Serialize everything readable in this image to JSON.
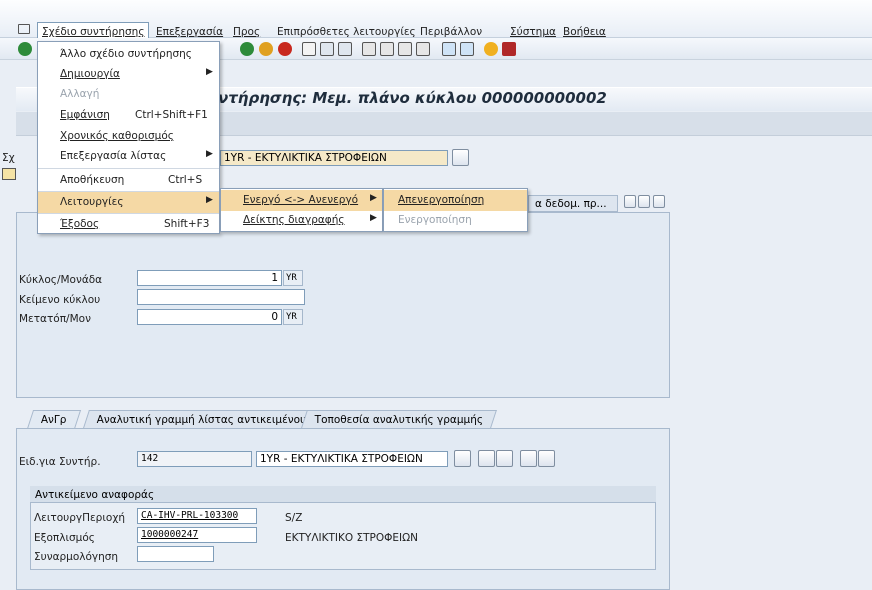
{
  "menubar": {
    "items": [
      "Σχέδιο συντήρησης",
      "Επεξεργασία",
      "Προς",
      "Επιπρόσθετες λειτουργίες",
      "Περιβάλλον",
      "Σύστημα",
      "Βοήθεια"
    ]
  },
  "title": "ντήρησης: Μεμ. πλάνο κύκλου 000000000002",
  "header": {
    "plan_label_partial": "Σχ",
    "plan_text": "1YR - ΕΚΤΥΛΙΚΤΙΚΑ ΣΤΡΟΦΕΙΩΝ",
    "tab_text_partial": "α δεδομ. πρ..."
  },
  "menu_main": {
    "items": [
      {
        "label": "Άλλο σχέδιο συντήρησης",
        "shortcut": "",
        "submenu": false,
        "disabled": false
      },
      {
        "label": "Δημιουργία",
        "shortcut": "",
        "submenu": true,
        "disabled": false
      },
      {
        "label": "Αλλαγή",
        "shortcut": "",
        "submenu": false,
        "disabled": true
      },
      {
        "label": "Εμφάνιση",
        "shortcut": "Ctrl+Shift+F1",
        "submenu": false,
        "disabled": false
      },
      {
        "label": "Χρονικός καθορισμός",
        "shortcut": "",
        "submenu": false,
        "disabled": false
      },
      {
        "label": "Επεξεργασία λίστας",
        "shortcut": "",
        "submenu": true,
        "disabled": false
      },
      {
        "label": "Αποθήκευση",
        "shortcut": "Ctrl+S",
        "submenu": false,
        "disabled": false
      },
      {
        "label": "Λειτουργίες",
        "shortcut": "",
        "submenu": true,
        "disabled": false
      },
      {
        "label": "Έξοδος",
        "shortcut": "Shift+F3",
        "submenu": false,
        "disabled": false
      }
    ]
  },
  "menu_functions": {
    "items": [
      {
        "label": "Ενεργό <-> Ανενεργό",
        "submenu": true
      },
      {
        "label": "Δείκτης διαγραφής",
        "submenu": true
      }
    ]
  },
  "menu_active": {
    "items": [
      {
        "label": "Απενεργοποίηση",
        "disabled": false
      },
      {
        "label": "Ενεργοποίηση",
        "disabled": true
      }
    ]
  },
  "cycle": {
    "cycle_label": "Κύκλος/Μονάδα",
    "cycle_value": "1",
    "cycle_unit": "YR",
    "text_label": "Κείμενο κύκλου",
    "text_value": "",
    "offset_label": "Μετατόπ/Μον",
    "offset_value": "0",
    "offset_unit": "YR"
  },
  "tabs": [
    "ΑνΓρ",
    "Αναλυτική γραμμή λίστας αντικειμένου",
    "Τοποθεσία αναλυτικής γραμμής"
  ],
  "item": {
    "plan_label": "Ειδ.για Συντήρ.",
    "plan_value": "142",
    "plan_desc": "1YR - ΕΚΤΥΛΙΚΤΙΚΑ ΣΤΡΟΦΕΙΩΝ",
    "ref_title": "Αντικείμενο αναφοράς",
    "floc_label": "ΛειτουργΠεριοχή",
    "floc_value": "CA-IHV-PRL-103300",
    "floc_desc": "S/Z",
    "equip_label": "Εξοπλισμός",
    "equip_value": "1000000247",
    "equip_desc": "ΕΚΤΥΛΙΚΤΙΚΟ ΣΤΡΟΦΕΙΩΝ",
    "assembly_label": "Συναρμολόγηση",
    "assembly_value": ""
  },
  "colors": {
    "highlight": "#f5d9a5",
    "border": "#7f9db9",
    "panel": "#e2eaf3"
  }
}
